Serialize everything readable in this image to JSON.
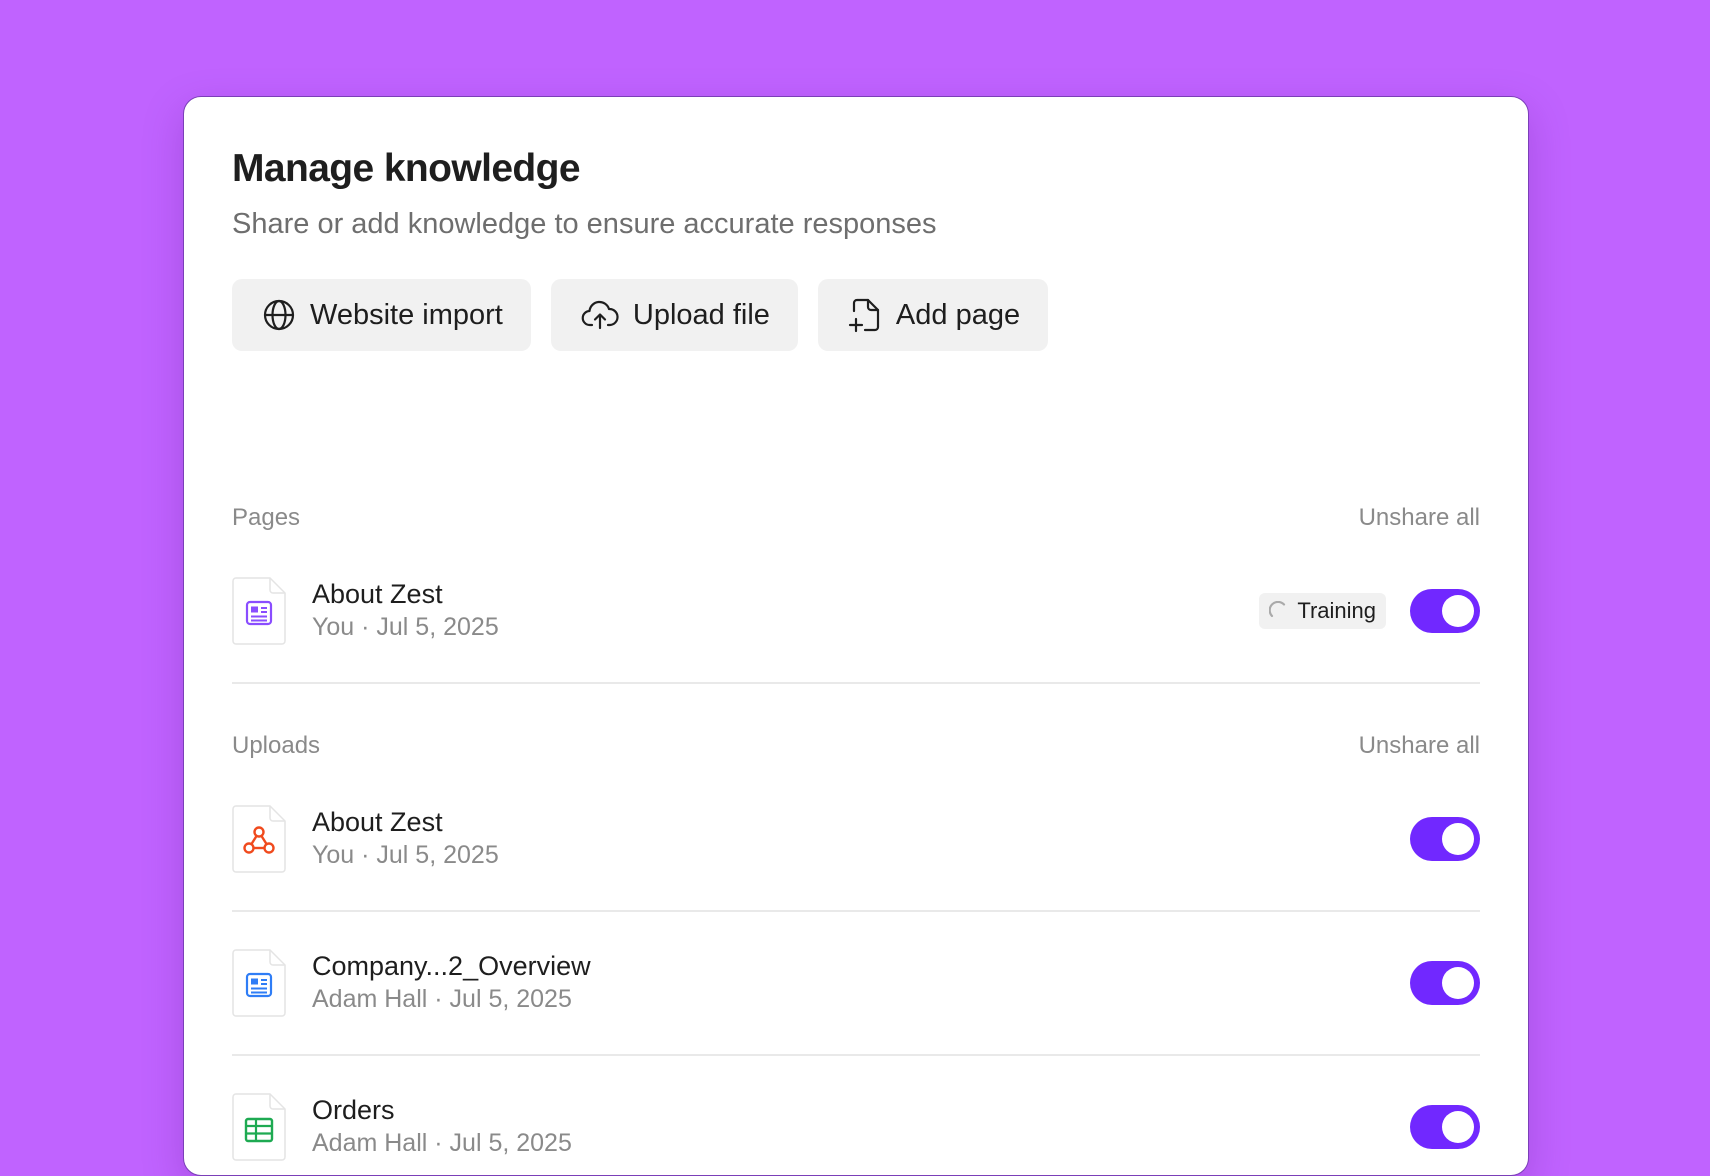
{
  "header": {
    "title": "Manage knowledge",
    "subtitle": "Share or add knowledge to ensure accurate responses"
  },
  "actions": [
    {
      "label": "Website import",
      "icon": "globe-icon"
    },
    {
      "label": "Upload file",
      "icon": "cloud-upload-icon"
    },
    {
      "label": "Add page",
      "icon": "add-page-icon"
    }
  ],
  "pages": {
    "label": "Pages",
    "unshare_label": "Unshare all",
    "items": [
      {
        "name": "About Zest",
        "meta": "You · Jul 5, 2025",
        "icon": "page-doc-icon",
        "icon_color": "#8a4dff",
        "status": "Training",
        "shared": true
      }
    ]
  },
  "uploads": {
    "label": "Uploads",
    "unshare_label": "Unshare all",
    "items": [
      {
        "name": "About Zest",
        "meta": "You · Jul 5, 2025",
        "icon": "pdf-icon",
        "icon_color": "#f04a1d",
        "shared": true
      },
      {
        "name": "Company...2_Overview",
        "meta": "Adam Hall · Jul 5, 2025",
        "icon": "doc-icon",
        "icon_color": "#2f7df6",
        "shared": true
      },
      {
        "name": "Orders",
        "meta": "Adam Hall · Jul 5, 2025",
        "icon": "sheet-icon",
        "icon_color": "#1eaa52",
        "shared": true
      }
    ]
  },
  "colors": {
    "background": "#c063ff",
    "accent": "#7128ff"
  }
}
